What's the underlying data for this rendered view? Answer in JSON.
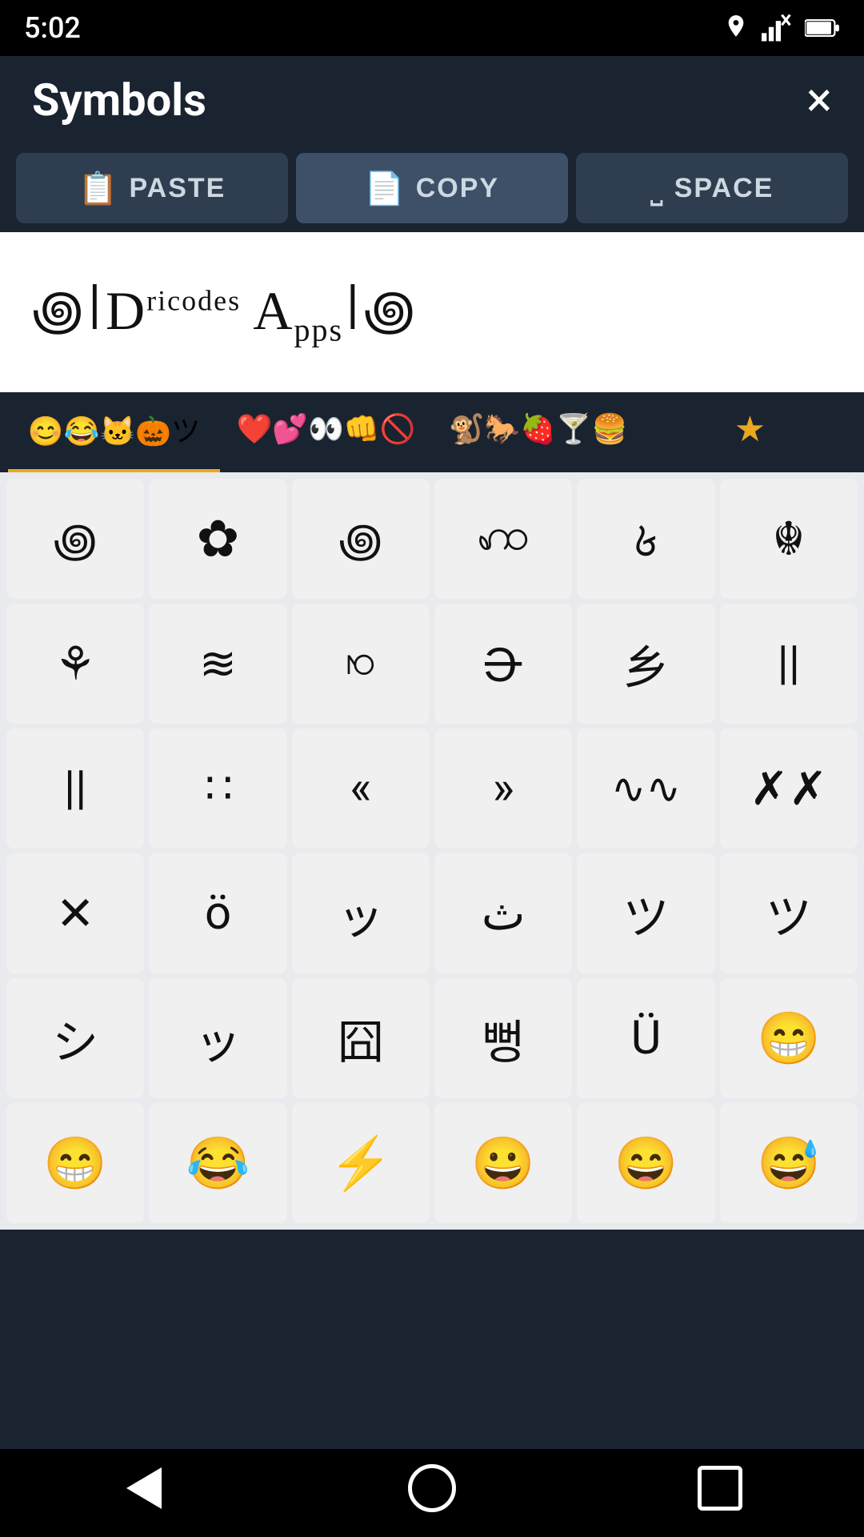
{
  "statusBar": {
    "time": "5:02",
    "icons": [
      "location",
      "signal",
      "battery"
    ]
  },
  "header": {
    "title": "Symbols",
    "closeLabel": "×"
  },
  "actionBar": {
    "buttons": [
      {
        "id": "paste",
        "label": "PASTE",
        "icon": "📋"
      },
      {
        "id": "copy",
        "label": "COPY",
        "icon": "📄"
      },
      {
        "id": "space",
        "label": "SPACE",
        "icon": "⎵"
      }
    ]
  },
  "textDisplay": {
    "content": "꩜𑁇Dricodes Apps𑁇꩜"
  },
  "categoryTabs": [
    {
      "id": "smiley",
      "emoji": "😊😂🐱🎃ツ"
    },
    {
      "id": "hearts",
      "emoji": "❤️💕👀👊🚫"
    },
    {
      "id": "animals",
      "emoji": "🐒🐎🍓🍸🍔"
    },
    {
      "id": "favorites",
      "emoji": "⭐"
    }
  ],
  "symbols": [
    "꩜",
    "❁",
    "꩜",
    "꣜",
    "꣙",
    "☬",
    "⚘",
    "≋",
    "ꩯ",
    "𑁌",
    "乡",
    "||",
    "||",
    "∷",
    "《",
    "》",
    "∿∿",
    "✗✗",
    "✕",
    "ö",
    "ッ",
    "ث",
    "ツ",
    "ツ",
    "シ",
    "ッ",
    "囧",
    "뻥",
    "Ü",
    "😁",
    "😁",
    "😂",
    "⚡",
    "😀",
    "😄",
    "😅"
  ],
  "navBar": {
    "back": "back",
    "home": "home",
    "recent": "recent"
  }
}
